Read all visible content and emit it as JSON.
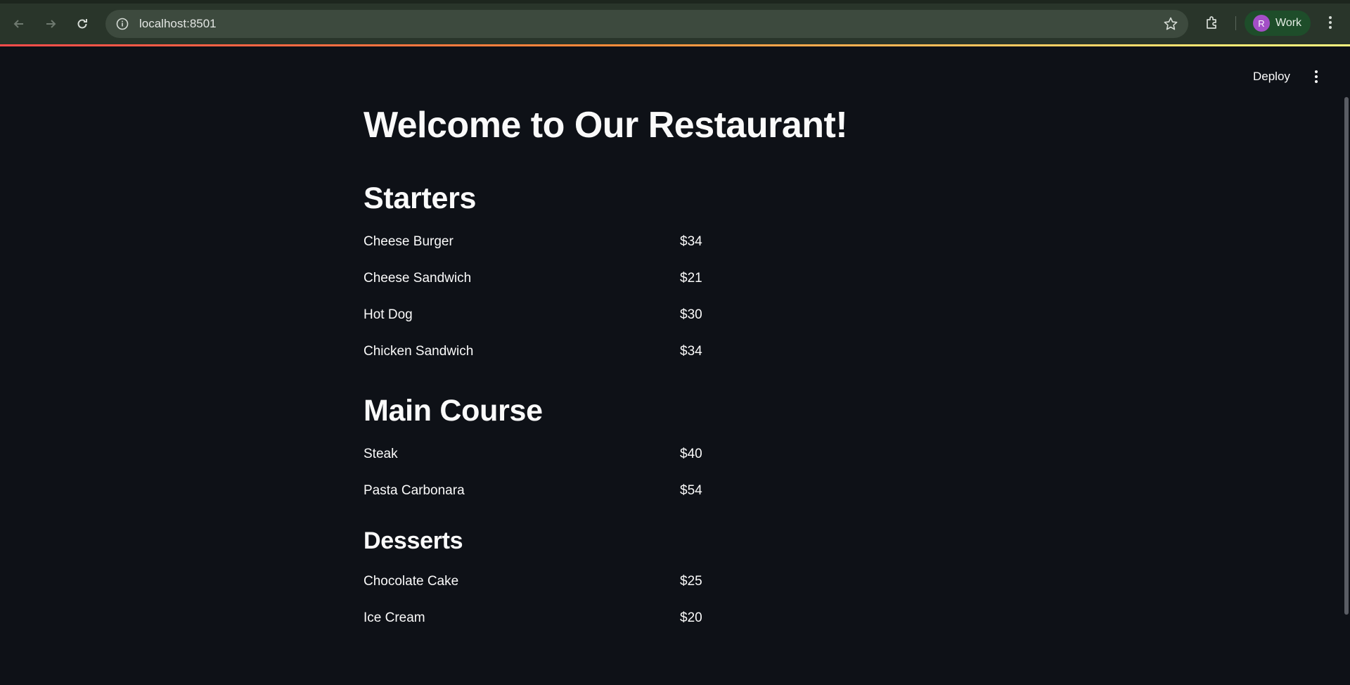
{
  "browser": {
    "url": "localhost:8501",
    "profile_initial": "R",
    "profile_label": "Work"
  },
  "header": {
    "deploy_label": "Deploy"
  },
  "page": {
    "title": "Welcome to Our Restaurant!",
    "sections": [
      {
        "heading": "Starters",
        "items": [
          {
            "name": "Cheese Burger",
            "price": "$34"
          },
          {
            "name": "Cheese Sandwich",
            "price": "$21"
          },
          {
            "name": "Hot Dog",
            "price": "$30"
          },
          {
            "name": "Chicken Sandwich",
            "price": "$34"
          }
        ]
      },
      {
        "heading": "Main Course",
        "items": [
          {
            "name": "Steak",
            "price": "$40"
          },
          {
            "name": "Pasta Carbonara",
            "price": "$54"
          }
        ]
      },
      {
        "heading": "Desserts",
        "items": [
          {
            "name": "Chocolate Cake",
            "price": "$25"
          },
          {
            "name": "Ice Cream",
            "price": "$20"
          }
        ]
      }
    ]
  },
  "colors": {
    "background": "#0e1117",
    "text": "#fafafa",
    "browser_bar": "#29352a",
    "accent_gradient_start": "#ff4b4b",
    "accent_gradient_end": "#fffd80"
  }
}
